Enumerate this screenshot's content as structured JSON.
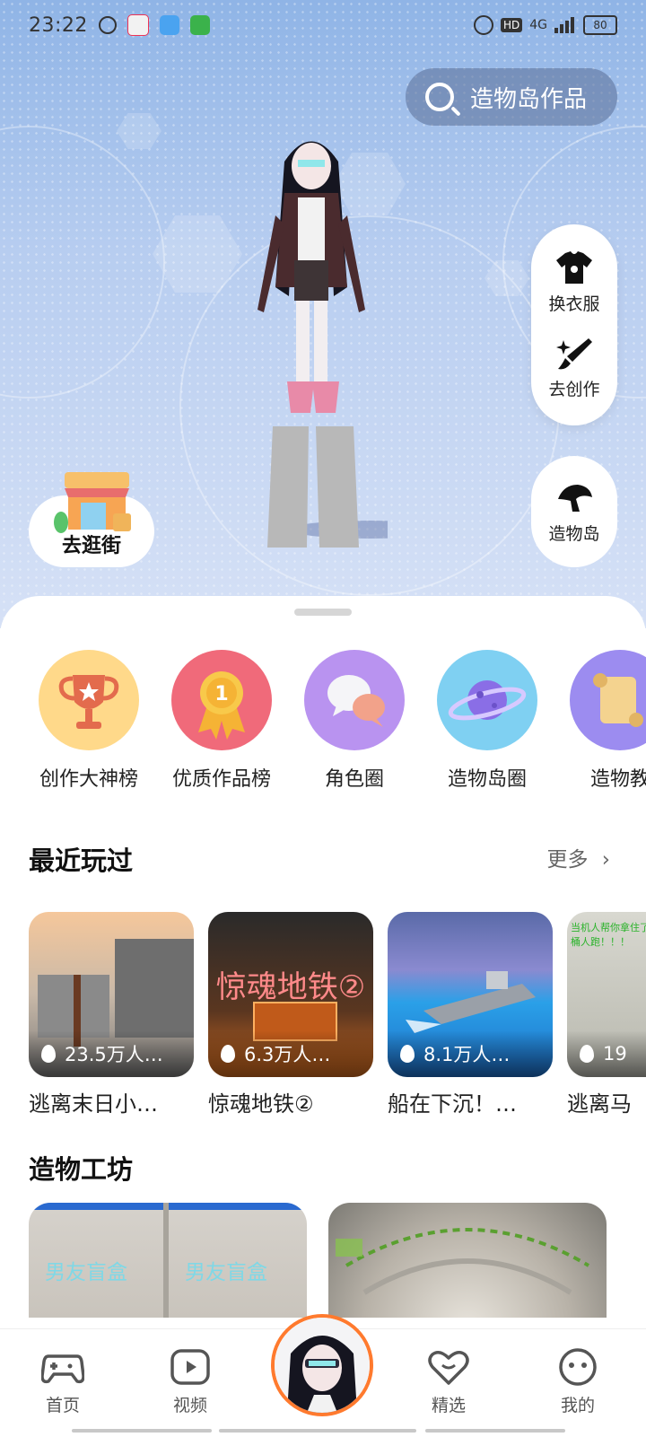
{
  "status_bar": {
    "time": "23:22",
    "network": "4G",
    "battery": "80"
  },
  "search": {
    "label": "造物岛作品"
  },
  "side_actions": {
    "change_outfit": "换衣服",
    "create": "去创作",
    "island": "造物岛"
  },
  "stroll": {
    "label": "去逛街"
  },
  "categories": [
    {
      "label": "创作大神榜"
    },
    {
      "label": "优质作品榜"
    },
    {
      "label": "角色圈"
    },
    {
      "label": "造物岛圈"
    },
    {
      "label": "造物教"
    }
  ],
  "recent": {
    "title": "最近玩过",
    "more": "更多",
    "items": [
      {
        "name": "逃离末日小…",
        "stat": "23.5万人…"
      },
      {
        "name": "惊魂地铁②",
        "stat": "6.3万人…",
        "overlay": "惊魂地铁②"
      },
      {
        "name": "船在下沉！…",
        "stat": "8.1万人…"
      },
      {
        "name": "逃离马",
        "stat": "19",
        "overlay": "当机人帮你拿住了马桶人跑！！！"
      }
    ]
  },
  "workshop": {
    "title": "造物工坊",
    "items": [
      {
        "overlay_left": "男友盲盒",
        "overlay_right": "男友盲盒"
      },
      {}
    ]
  },
  "tabbar": {
    "home": "首页",
    "video": "视频",
    "featured": "精选",
    "mine": "我的"
  },
  "colors": {
    "accent": "#ff7a2e"
  }
}
